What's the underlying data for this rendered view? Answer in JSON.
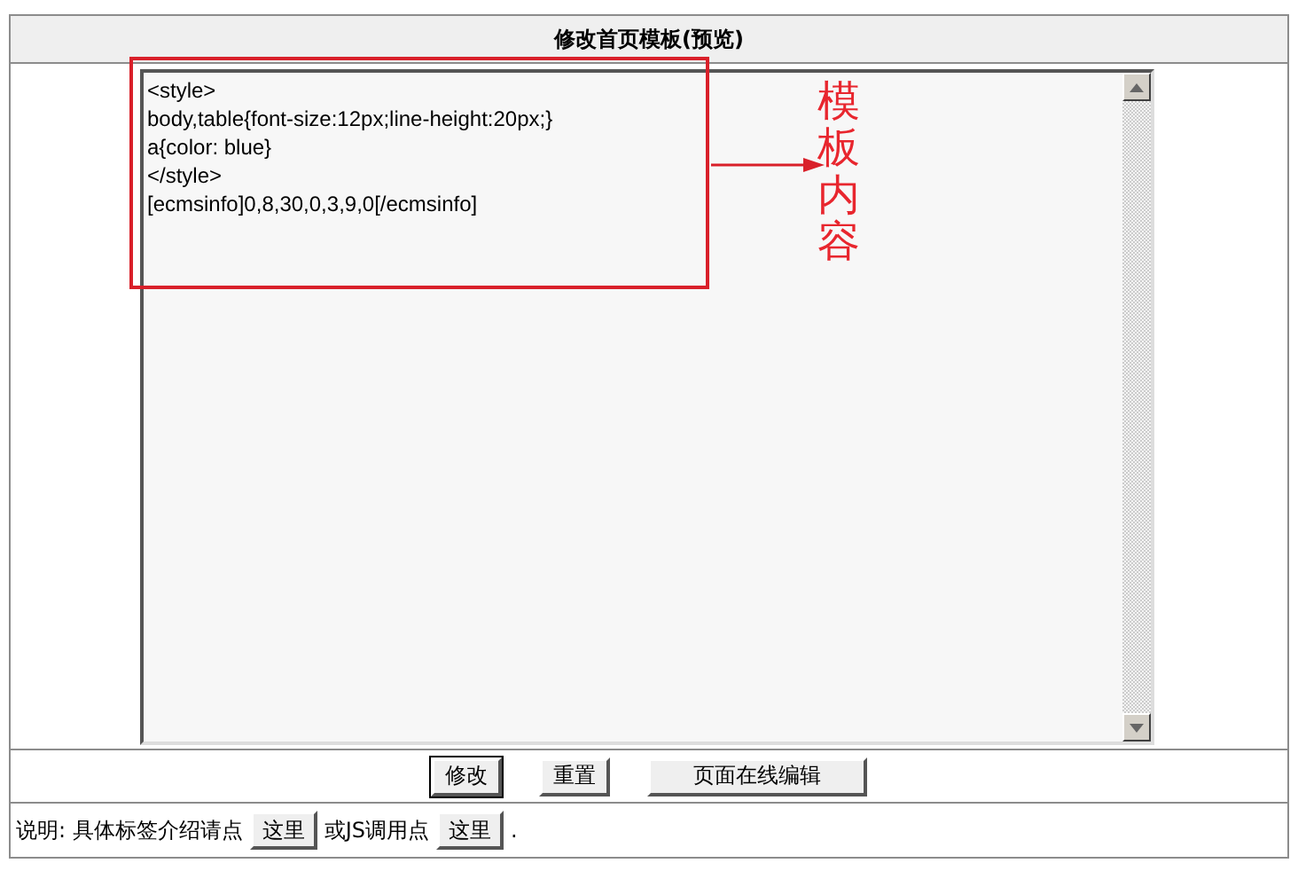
{
  "header": {
    "title": "修改首页模板(预览)"
  },
  "editor": {
    "value": "<style>\nbody,table{font-size:12px;line-height:20px;}\na{color: blue}\n</style>\n[ecmsinfo]0,8,30,0,3,9,0[/ecmsinfo]"
  },
  "annotation": {
    "label": "模板内容"
  },
  "buttons": [
    {
      "label": "修改",
      "selected": true
    },
    {
      "label": "重置",
      "selected": false
    },
    {
      "label": "页面在线编辑",
      "selected": false
    }
  ],
  "note": [
    {
      "kind": "text",
      "text": "说明: 具体标签介绍请点"
    },
    {
      "kind": "button",
      "text": "这里"
    },
    {
      "kind": "text",
      "text": "或JS调用点"
    },
    {
      "kind": "button",
      "text": "这里"
    },
    {
      "kind": "text",
      "text": "."
    }
  ]
}
